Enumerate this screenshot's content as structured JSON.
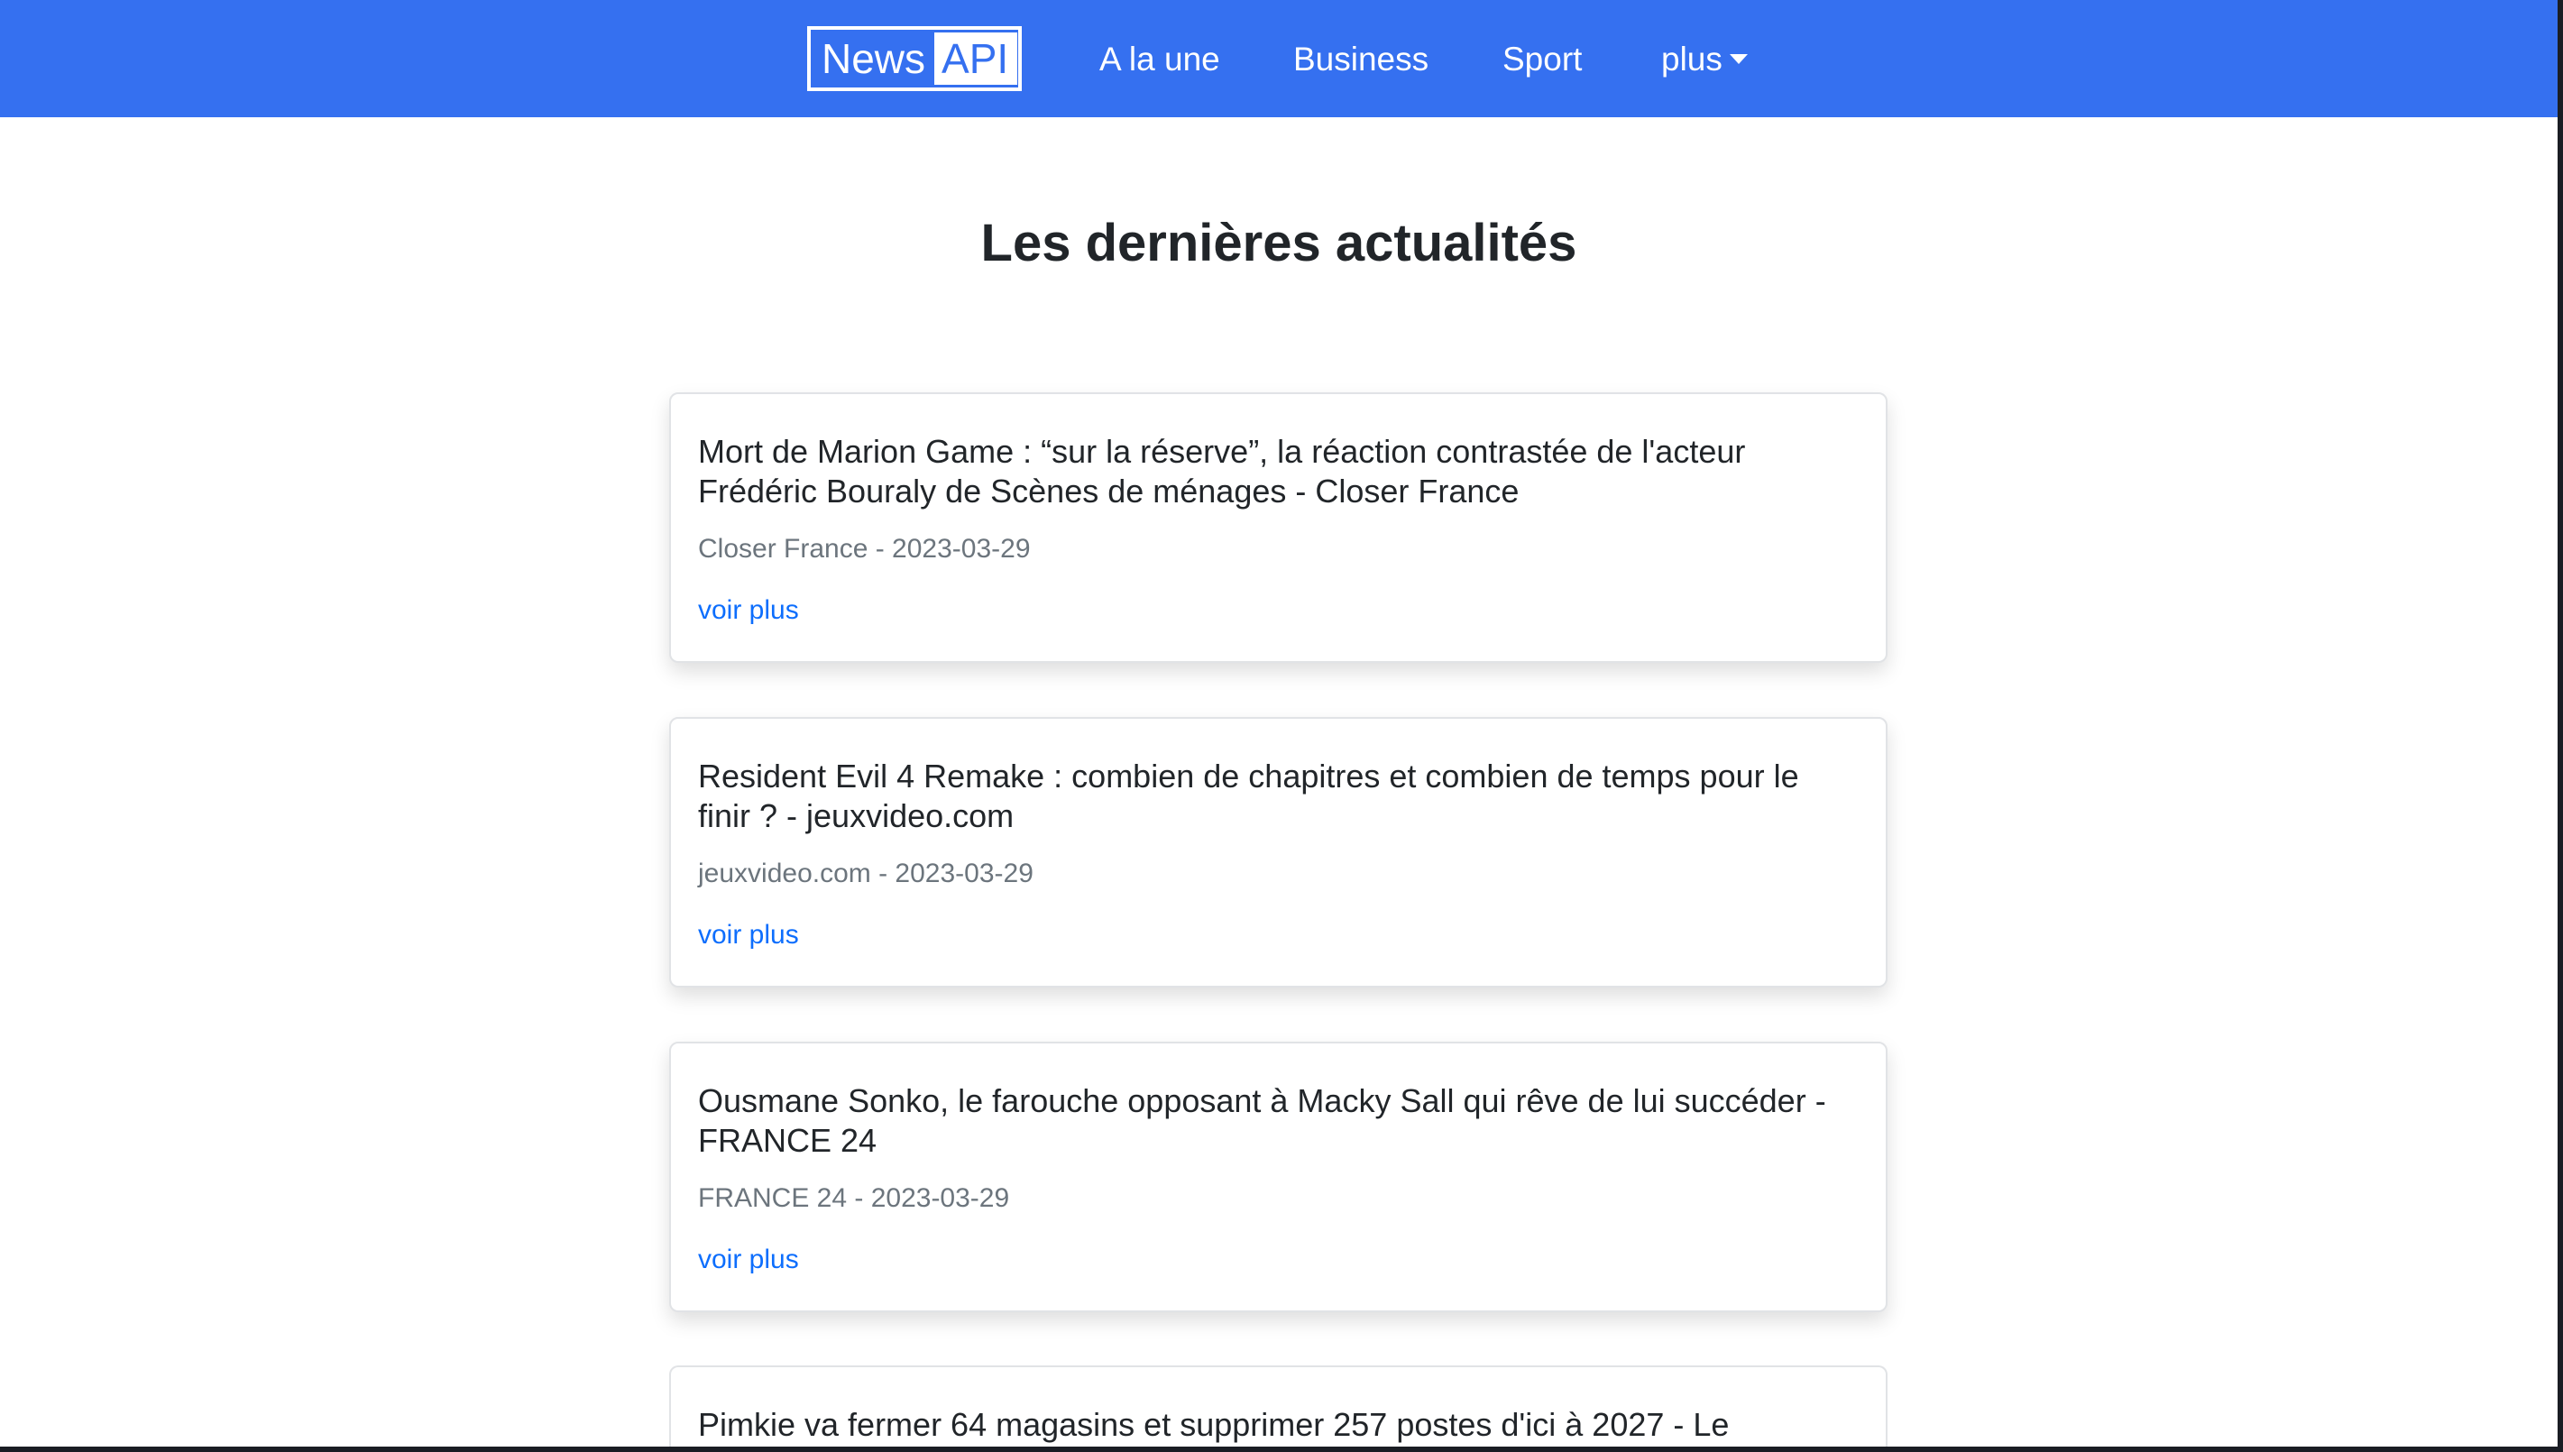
{
  "navbar": {
    "brand": {
      "part1": "News",
      "part2": "API"
    },
    "links": [
      {
        "label": "A la une"
      },
      {
        "label": "Business"
      },
      {
        "label": "Sport"
      },
      {
        "label": "plus"
      }
    ],
    "background_color": "#3570f0"
  },
  "main": {
    "title": "Les dernières actualités",
    "articles": [
      {
        "title": "Mort de Marion Game : “sur la réserve”, la réaction contrastée de l'acteur Frédéric Bouraly de Scènes de ménages - Closer France",
        "meta": "Closer France - 2023-03-29",
        "link": "voir plus"
      },
      {
        "title": "Resident Evil 4 Remake : combien de chapitres et combien de temps pour le finir ? - jeuxvideo.com",
        "meta": "jeuxvideo.com - 2023-03-29",
        "link": "voir plus"
      },
      {
        "title": "Ousmane Sonko, le farouche opposant à Macky Sall qui rêve de lui succéder - FRANCE 24",
        "meta": "FRANCE 24 - 2023-03-29",
        "link": "voir plus"
      },
      {
        "title": "Pimkie va fermer 64 magasins et supprimer 257 postes d'ici à 2027 - Le",
        "meta": "",
        "link": ""
      }
    ],
    "link_color": "#0d6efd",
    "meta_color": "#6c757d"
  }
}
